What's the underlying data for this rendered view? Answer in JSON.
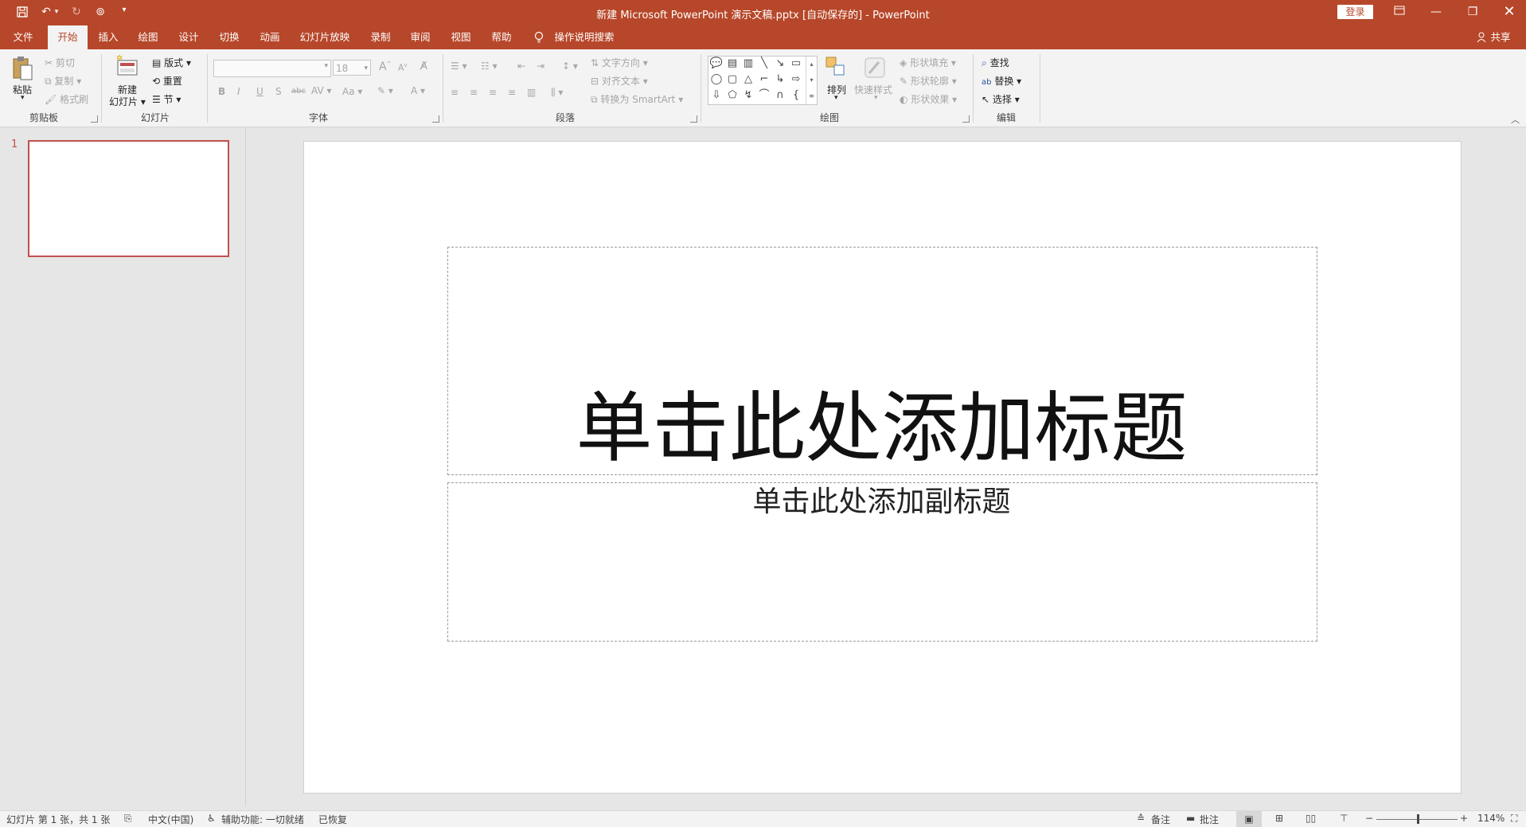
{
  "titlebar": {
    "title": "新建 Microsoft PowerPoint 演示文稿.pptx [自动保存的]  -  PowerPoint",
    "login": "登录",
    "icons": [
      "save-icon",
      "undo-icon",
      "redo-icon",
      "presenter-icon",
      "customize-icon"
    ]
  },
  "tabs": [
    "文件",
    "开始",
    "插入",
    "绘图",
    "设计",
    "切换",
    "动画",
    "幻灯片放映",
    "录制",
    "审阅",
    "视图",
    "帮助"
  ],
  "active_tab": "开始",
  "tell_me": "操作说明搜索",
  "share": "共享",
  "ribbon": {
    "clipboard": {
      "label": "剪贴板",
      "paste": "粘贴",
      "cut": "剪切",
      "copy": "复制",
      "format_painter": "格式刷"
    },
    "slides": {
      "label": "幻灯片",
      "new_slide_1": "新建",
      "new_slide_2": "幻灯片",
      "layout": "版式",
      "reset": "重置",
      "section": "节"
    },
    "font": {
      "label": "字体",
      "font_name": "",
      "font_size": "18"
    },
    "paragraph": {
      "label": "段落",
      "text_direction": "文字方向",
      "align_text": "对齐文本",
      "convert_smartart": "转换为 SmartArt"
    },
    "drawing": {
      "label": "绘图",
      "arrange": "排列",
      "quick_styles": "快速样式",
      "shape_fill": "形状填充",
      "shape_outline": "形状轮廓",
      "shape_effects": "形状效果"
    },
    "editing": {
      "label": "编辑",
      "find": "查找",
      "replace": "替换",
      "select": "选择"
    }
  },
  "thumbnail": {
    "number": "1"
  },
  "slide": {
    "title_placeholder": "单击此处添加标题",
    "subtitle_placeholder": "单击此处添加副标题"
  },
  "statusbar": {
    "slide_info": "幻灯片 第 1 张，共 1 张",
    "language": "中文(中国)",
    "accessibility": "辅助功能: 一切就绪",
    "recovered": "已恢复",
    "notes": "备注",
    "comments": "批注",
    "zoom": "114%"
  },
  "colors": {
    "accent": "#b7472a",
    "thumbnail_border": "#c0504d"
  }
}
